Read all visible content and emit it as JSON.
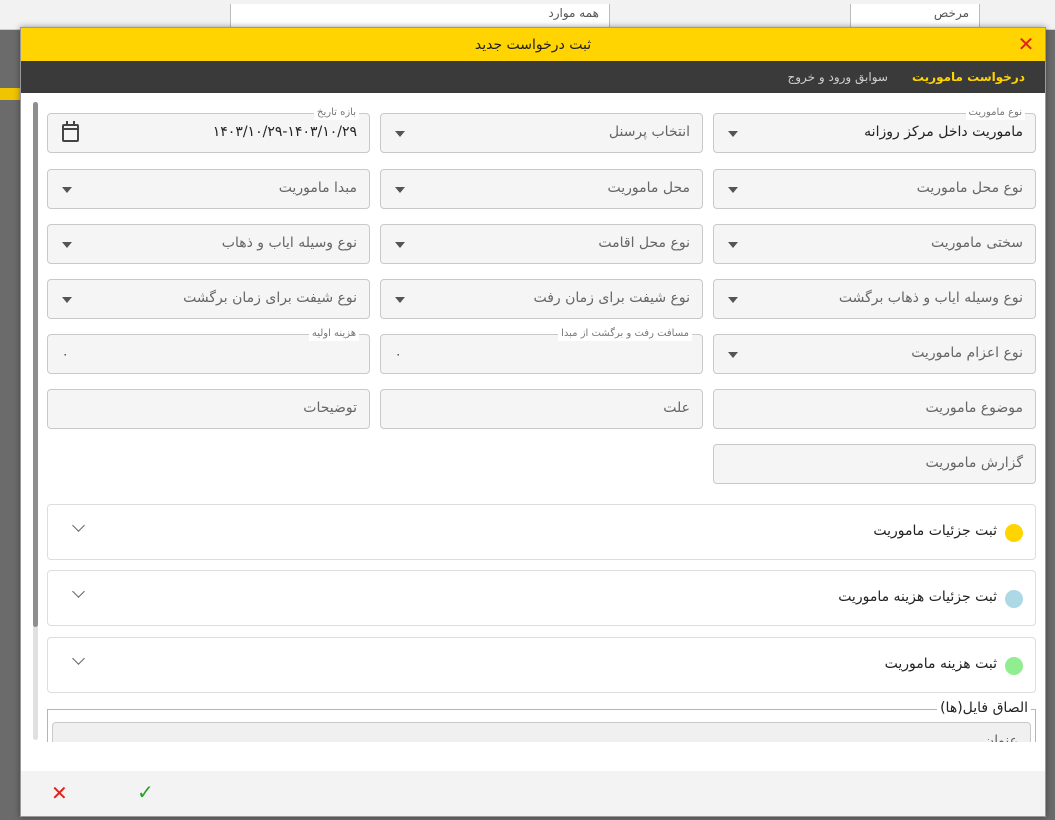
{
  "backdrop": {
    "field1": "مرخص",
    "field2": "همه موارد"
  },
  "dialog": {
    "title": "ثبت درخواست جدید",
    "close_glyph": "✕"
  },
  "tabs": [
    {
      "label": "درخواست ماموریت",
      "active": true
    },
    {
      "label": "سوابق ورود و خروج",
      "active": false
    }
  ],
  "form": {
    "mission_type": {
      "legend": "نوع ماموریت",
      "value": "ماموریت داخل مرکز روزانه"
    },
    "personnel": {
      "placeholder": "انتخاب پرسنل"
    },
    "date_range": {
      "legend": "بازه تاریخ",
      "value": "۱۴۰۳/۱۰/۲۹-۱۴۰۳/۱۰/۲۹"
    },
    "mission_place_type": {
      "placeholder": "نوع محل ماموریت"
    },
    "mission_place": {
      "placeholder": "محل ماموریت"
    },
    "mission_origin": {
      "placeholder": "مبدا ماموریت"
    },
    "mission_difficulty": {
      "placeholder": "سختی ماموریت"
    },
    "residence_type": {
      "placeholder": "نوع محل اقامت"
    },
    "transport_type": {
      "placeholder": "نوع وسیله ایاب و ذهاب"
    },
    "return_transport_type": {
      "placeholder": "نوع وسیله ایاب و ذهاب برگشت"
    },
    "departure_shift_type": {
      "placeholder": "نوع شیفت برای زمان رفت"
    },
    "return_shift_type": {
      "placeholder": "نوع شیفت برای زمان برگشت"
    },
    "dispatch_type": {
      "placeholder": "نوع اعزام ماموریت"
    },
    "round_trip_distance": {
      "legend": "مسافت رفت و برگشت از مبدا",
      "value": "۰"
    },
    "initial_cost": {
      "legend": "هزینه اولیه",
      "value": "۰"
    },
    "mission_subject": {
      "placeholder": "موضوع ماموریت"
    },
    "reason": {
      "placeholder": "علت"
    },
    "description": {
      "placeholder": "توضیحات"
    },
    "mission_report": {
      "placeholder": "گزارش ماموریت"
    }
  },
  "sections": [
    {
      "title": "ثبت جزئیات ماموریت",
      "color": "#ffd400"
    },
    {
      "title": "ثبت جزئیات هزینه ماموریت",
      "color": "#add8e6"
    },
    {
      "title": "ثبت هزینه ماموریت",
      "color": "#90ee90"
    }
  ],
  "attachments": {
    "legend": "الصاق فایل(ها)",
    "title_placeholder": "عنوان"
  },
  "footer": {
    "cancel_glyph": "✕",
    "confirm_glyph": "✓"
  },
  "colors": {
    "accent": "#ffd400",
    "tabbar": "#3a3a3a",
    "danger": "#e0201a",
    "success": "#2aa02a"
  }
}
